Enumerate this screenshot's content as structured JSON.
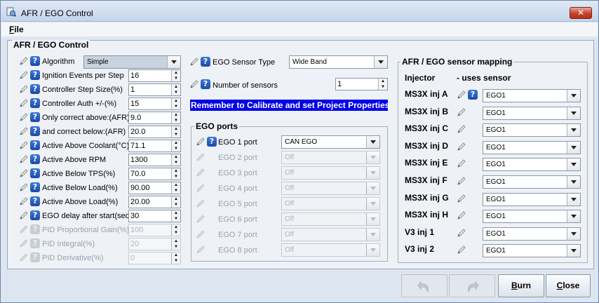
{
  "window": {
    "title": "AFR / EGO Control",
    "close_glyph": "✕"
  },
  "menu": {
    "file_first": "F",
    "file_rest": "ile"
  },
  "panel": {
    "title": "AFR / EGO Control"
  },
  "left_fields": [
    {
      "label": "Algorithm",
      "type": "combo",
      "value": "Simple",
      "enabled": true
    },
    {
      "label": "Ignition Events per Step",
      "type": "spinner",
      "value": "16",
      "enabled": true
    },
    {
      "label": "Controller Step Size(%)",
      "type": "spinner",
      "value": "1",
      "enabled": true
    },
    {
      "label": "Controller Auth +/-(%)",
      "type": "spinner",
      "value": "15",
      "enabled": true
    },
    {
      "label": "Only correct above:(AFR)",
      "type": "spinner",
      "value": "9.0",
      "enabled": true
    },
    {
      "label": "and correct below:(AFR)",
      "type": "spinner",
      "value": "20.0",
      "enabled": true
    },
    {
      "label": "Active Above Coolant(°C)",
      "type": "spinner",
      "value": "71.1",
      "enabled": true
    },
    {
      "label": "Active Above RPM",
      "type": "spinner",
      "value": "1300",
      "enabled": true
    },
    {
      "label": "Active Below TPS(%)",
      "type": "spinner",
      "value": "70.0",
      "enabled": true
    },
    {
      "label": "Active Below Load(%)",
      "type": "spinner",
      "value": "90.00",
      "enabled": true
    },
    {
      "label": "Active Above Load(%)",
      "type": "spinner",
      "value": "20.00",
      "enabled": true
    },
    {
      "label": "EGO delay after start(sec)",
      "type": "spinner",
      "value": "30",
      "enabled": true
    },
    {
      "label": "PID Proportional Gain(%)",
      "type": "spinner",
      "value": "100",
      "enabled": false
    },
    {
      "label": "PID Integral(%)",
      "type": "spinner",
      "value": "20",
      "enabled": false
    },
    {
      "label": "PID Derivative(%)",
      "type": "spinner",
      "value": "0",
      "enabled": false
    }
  ],
  "middle": {
    "sensor_type_label": "EGO Sensor Type",
    "sensor_type_value": "Wide Band",
    "num_sensors_label": "Number of sensors",
    "num_sensors_value": "1",
    "notice": "Remember to Calibrate and set Project Properties",
    "ports_title": "EGO ports",
    "ports": [
      {
        "label": "EGO 1 port",
        "value": "CAN EGO",
        "enabled": true
      },
      {
        "label": "EGO 2 port",
        "value": "Off",
        "enabled": false
      },
      {
        "label": "EGO 3 port",
        "value": "Off",
        "enabled": false
      },
      {
        "label": "EGO 4 port",
        "value": "Off",
        "enabled": false
      },
      {
        "label": "EGO 5 port",
        "value": "Off",
        "enabled": false
      },
      {
        "label": "EGO 6 port",
        "value": "Off",
        "enabled": false
      },
      {
        "label": "EGO 7 port",
        "value": "Off",
        "enabled": false
      },
      {
        "label": "EGO 8 port",
        "value": "Off",
        "enabled": false
      }
    ]
  },
  "mapping": {
    "title": "AFR / EGO sensor mapping",
    "col_injector": "Injector",
    "col_sensor": "- uses sensor",
    "rows": [
      {
        "injector": "MS3X inj A",
        "sensor": "EGO1"
      },
      {
        "injector": "MS3X inj B",
        "sensor": "EGO1"
      },
      {
        "injector": "MS3X inj C",
        "sensor": "EGO1"
      },
      {
        "injector": "MS3X inj D",
        "sensor": "EGO1"
      },
      {
        "injector": "MS3X inj E",
        "sensor": "EGO1"
      },
      {
        "injector": "MS3X inj F",
        "sensor": "EGO1"
      },
      {
        "injector": "MS3X inj G",
        "sensor": "EGO1"
      },
      {
        "injector": "MS3X inj H",
        "sensor": "EGO1"
      },
      {
        "injector": "V3 inj 1",
        "sensor": "EGO1"
      },
      {
        "injector": "V3 inj 2",
        "sensor": "EGO1"
      }
    ]
  },
  "buttons": {
    "burn_first": "B",
    "burn_rest": "urn",
    "close_first": "C",
    "close_rest": "lose"
  },
  "icons": {
    "help_glyph": "?"
  }
}
